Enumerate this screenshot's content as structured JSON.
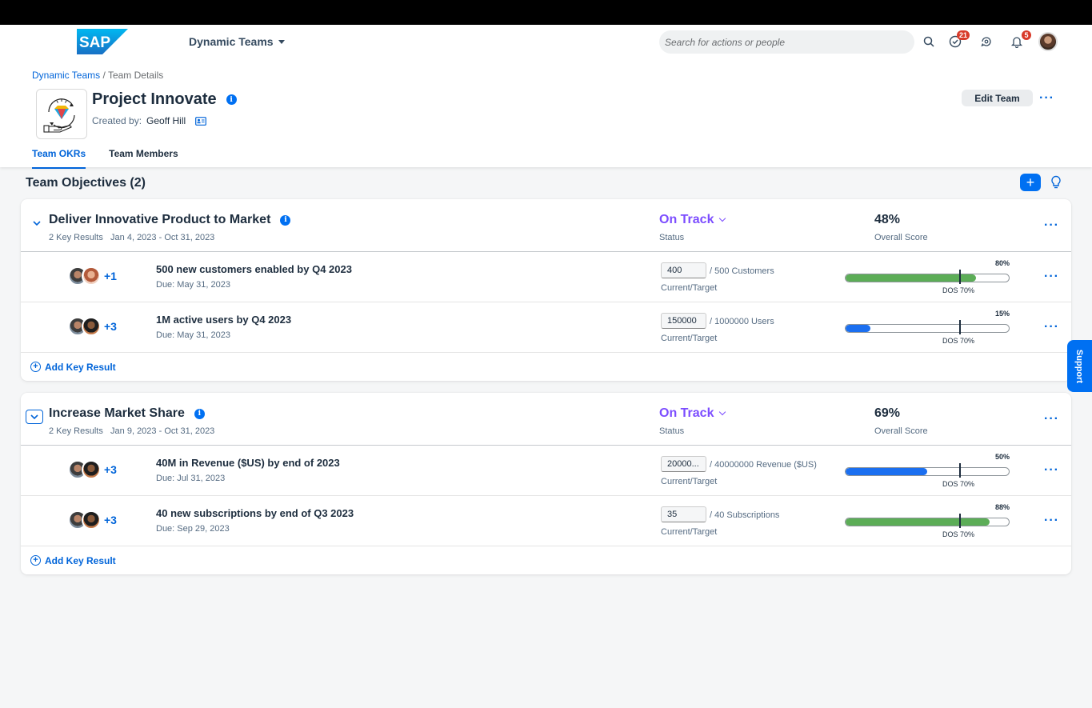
{
  "shell": {
    "app_title": "Dynamic Teams",
    "search_placeholder": "Search for actions or people",
    "tasks_count": "21",
    "notifications_count": "5",
    "logo_text": "SAP"
  },
  "breadcrumb": {
    "root": "Dynamic Teams",
    "separator": "/",
    "current": "Team Details"
  },
  "header": {
    "title": "Project Innovate",
    "created_by_label": "Created by:",
    "created_by": "Geoff Hill",
    "edit_button": "Edit Team",
    "more": "···"
  },
  "tabs": [
    {
      "label": "Team OKRs",
      "active": true
    },
    {
      "label": "Team Members",
      "active": false
    }
  ],
  "section": {
    "title": "Team Objectives (2)",
    "add": "+"
  },
  "objectives": [
    {
      "title": "Deliver Innovative Product to Market",
      "key_results_count": "2 Key Results",
      "dates": "Jan 4, 2023 - Oct 31, 2023",
      "status": "On Track",
      "status_label": "Status",
      "score": "48%",
      "score_label": "Overall Score",
      "more": "···",
      "add_kr": "Add Key Result",
      "key_results": [
        {
          "title": "500 new customers enabled by Q4 2023",
          "due": "Due: May 31, 2023",
          "extra_members": "+1",
          "current": "400",
          "target": "/ 500 Customers",
          "current_label": "Current/Target",
          "progress": 0.8,
          "progress_label": "80%",
          "dos": "DOS 70%",
          "dos_value": 0.7,
          "bar_color": "green",
          "more": "···"
        },
        {
          "title": "1M active users by Q4 2023",
          "due": "Due: May 31, 2023",
          "extra_members": "+3",
          "current": "150000",
          "target": "/ 1000000 Users",
          "current_label": "Current/Target",
          "progress": 0.15,
          "progress_label": "15%",
          "dos": "DOS 70%",
          "dos_value": 0.7,
          "bar_color": "blue",
          "more": "···"
        }
      ]
    },
    {
      "title": "Increase Market Share",
      "key_results_count": "2 Key Results",
      "dates": "Jan 9, 2023 - Oct 31, 2023",
      "status": "On Track",
      "status_label": "Status",
      "score": "69%",
      "score_label": "Overall Score",
      "more": "···",
      "add_kr": "Add Key Result",
      "key_results": [
        {
          "title": "40M in Revenue ($US) by end of 2023",
          "due": "Due: Jul 31, 2023",
          "extra_members": "+3",
          "current": "20000...",
          "target": "/ 40000000 Revenue ($US)",
          "current_label": "Current/Target",
          "progress": 0.5,
          "progress_label": "50%",
          "dos": "DOS 70%",
          "dos_value": 0.7,
          "bar_color": "blue",
          "more": "···"
        },
        {
          "title": "40 new subscriptions by end of Q3 2023",
          "due": "Due: Sep 29, 2023",
          "extra_members": "+3",
          "current": "35",
          "target": "/ 40 Subscriptions",
          "current_label": "Current/Target",
          "progress": 0.88,
          "progress_label": "88%",
          "dos": "DOS 70%",
          "dos_value": 0.7,
          "bar_color": "green",
          "more": "···"
        }
      ]
    }
  ],
  "support": "Support",
  "colors": {
    "accent": "#0070f2",
    "status": "#7c4dff",
    "progress_green": "#5cad57",
    "progress_blue": "#1b6ff0"
  }
}
